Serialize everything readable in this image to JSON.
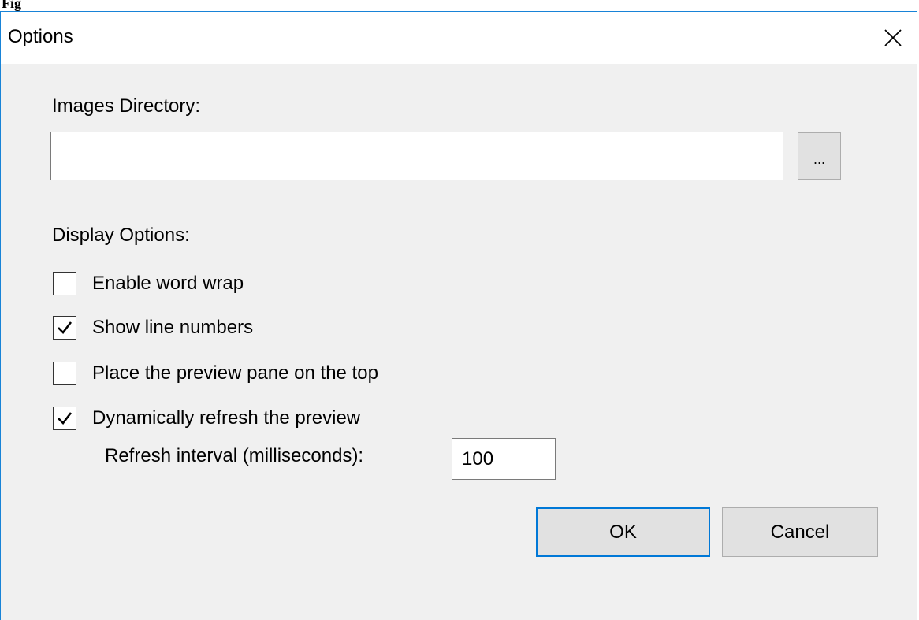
{
  "window": {
    "title": "Options",
    "close_glyph": "✕"
  },
  "images_directory": {
    "label": "Images Directory:",
    "value": "",
    "browse_label": "..."
  },
  "display_options": {
    "heading": "Display Options:",
    "items": [
      {
        "label": "Enable word wrap",
        "checked": false
      },
      {
        "label": "Show line numbers",
        "checked": true
      },
      {
        "label": "Place the preview pane on the top",
        "checked": false
      },
      {
        "label": "Dynamically refresh the preview",
        "checked": true
      }
    ],
    "refresh_interval": {
      "label": "Refresh interval (milliseconds):",
      "value": "100"
    }
  },
  "buttons": {
    "ok": "OK",
    "cancel": "Cancel"
  },
  "colors": {
    "accent": "#0078d7",
    "window_border": "#1883d7",
    "dialog_background": "#f0f0f0",
    "button_face": "#e1e1e1"
  },
  "icons": {
    "close": "close-icon",
    "checkmark": "checkmark-icon"
  }
}
